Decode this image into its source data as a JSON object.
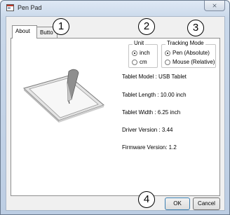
{
  "window": {
    "title": "Pen Pad",
    "close_glyph": "⨯"
  },
  "tabs": [
    {
      "label": "About",
      "active": true
    },
    {
      "label": "Butto",
      "active": false
    }
  ],
  "unit": {
    "legend": "Unit",
    "options": [
      {
        "label": "inch",
        "selected": true
      },
      {
        "label": "cm",
        "selected": false
      }
    ]
  },
  "tracking_mode": {
    "legend": "Tracking Mode",
    "options": [
      {
        "label": "Pen (Absolute)",
        "selected": true
      },
      {
        "label": "Mouse (Relative)",
        "selected": false
      }
    ]
  },
  "info": {
    "tablet_model": "Tablet Model : USB Tablet",
    "tablet_length": "Tablet Length : 10.00 inch",
    "tablet_width": "Tablet Width : 6.25 inch",
    "driver_version": "Driver Version : 3.44",
    "firmware_version": "Firmware Version: 1.2"
  },
  "buttons": {
    "ok": "OK",
    "cancel": "Cancel"
  },
  "callouts": [
    "1",
    "2",
    "3",
    "4"
  ]
}
